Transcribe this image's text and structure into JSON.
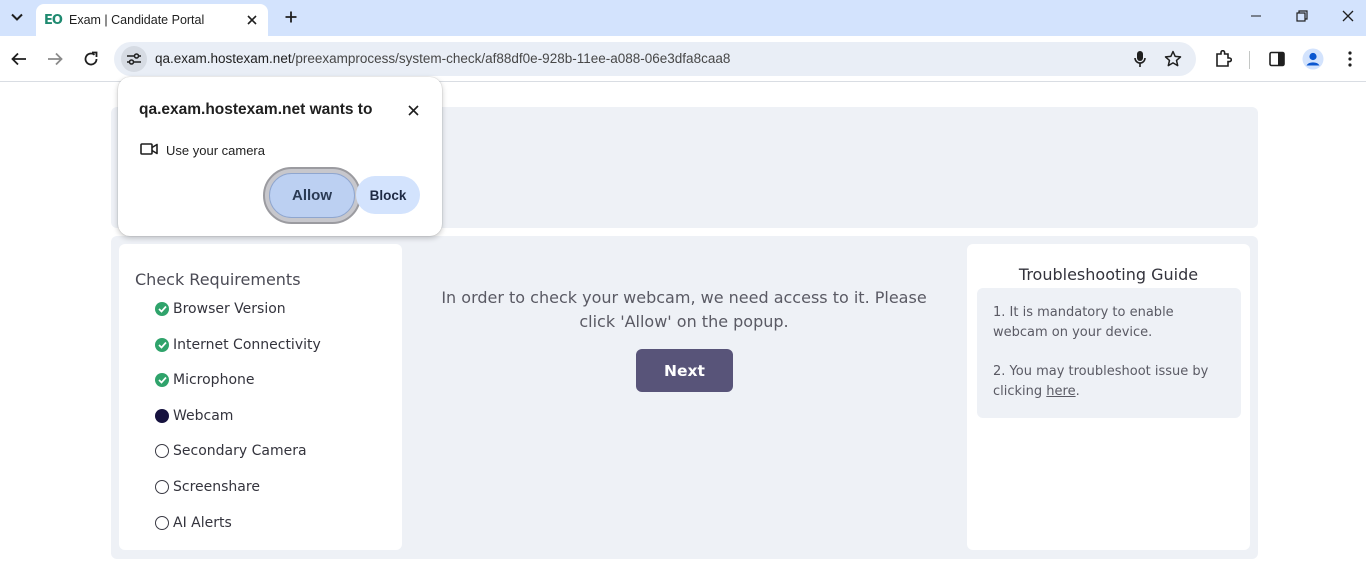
{
  "browser": {
    "tab": {
      "favicon_text": "EO",
      "title": "Exam | Candidate Portal"
    },
    "url": {
      "host": "qa.exam.hostexam.net",
      "path": "/preexamprocess/system-check/af88df0e-928b-11ee-a088-06e3dfa8caa8"
    },
    "icons": [
      "tab-search-icon",
      "close-icon",
      "new-tab-icon",
      "minimize-icon",
      "restore-icon",
      "window-close-icon",
      "back-icon",
      "forward-icon",
      "reload-icon",
      "site-info-icon",
      "microphone-icon",
      "bookmark-star-icon",
      "extensions-icon",
      "side-panel-icon",
      "profile-icon",
      "menu-icon"
    ]
  },
  "permission_popup": {
    "title": "qa.exam.hostexam.net wants to",
    "permission": "Use your camera",
    "allow_label": "Allow",
    "block_label": "Block"
  },
  "requirements": {
    "title": "Check Requirements",
    "items": [
      {
        "label": "Browser Version",
        "status": "done"
      },
      {
        "label": "Internet Connectivity",
        "status": "done"
      },
      {
        "label": "Microphone",
        "status": "done"
      },
      {
        "label": "Webcam",
        "status": "active"
      },
      {
        "label": "Secondary Camera",
        "status": "pending"
      },
      {
        "label": "Screenshare",
        "status": "pending"
      },
      {
        "label": "AI Alerts",
        "status": "pending"
      }
    ]
  },
  "main": {
    "message": "In order to check your webcam, we need access to it. Please click 'Allow' on the popup.",
    "next_label": "Next"
  },
  "troubleshooting": {
    "title": "Troubleshooting Guide",
    "tip1": "1. It is mandatory to enable webcam on your device.",
    "tip2_prefix": "2. You may troubleshoot issue by clicking ",
    "tip2_link": "here",
    "tip2_suffix": "."
  },
  "colors": {
    "tabstrip": "#d3e3fd",
    "done": "#2fa36b",
    "active": "#16123f",
    "next_button": "#585479",
    "panel_bg": "#eef1f6"
  }
}
